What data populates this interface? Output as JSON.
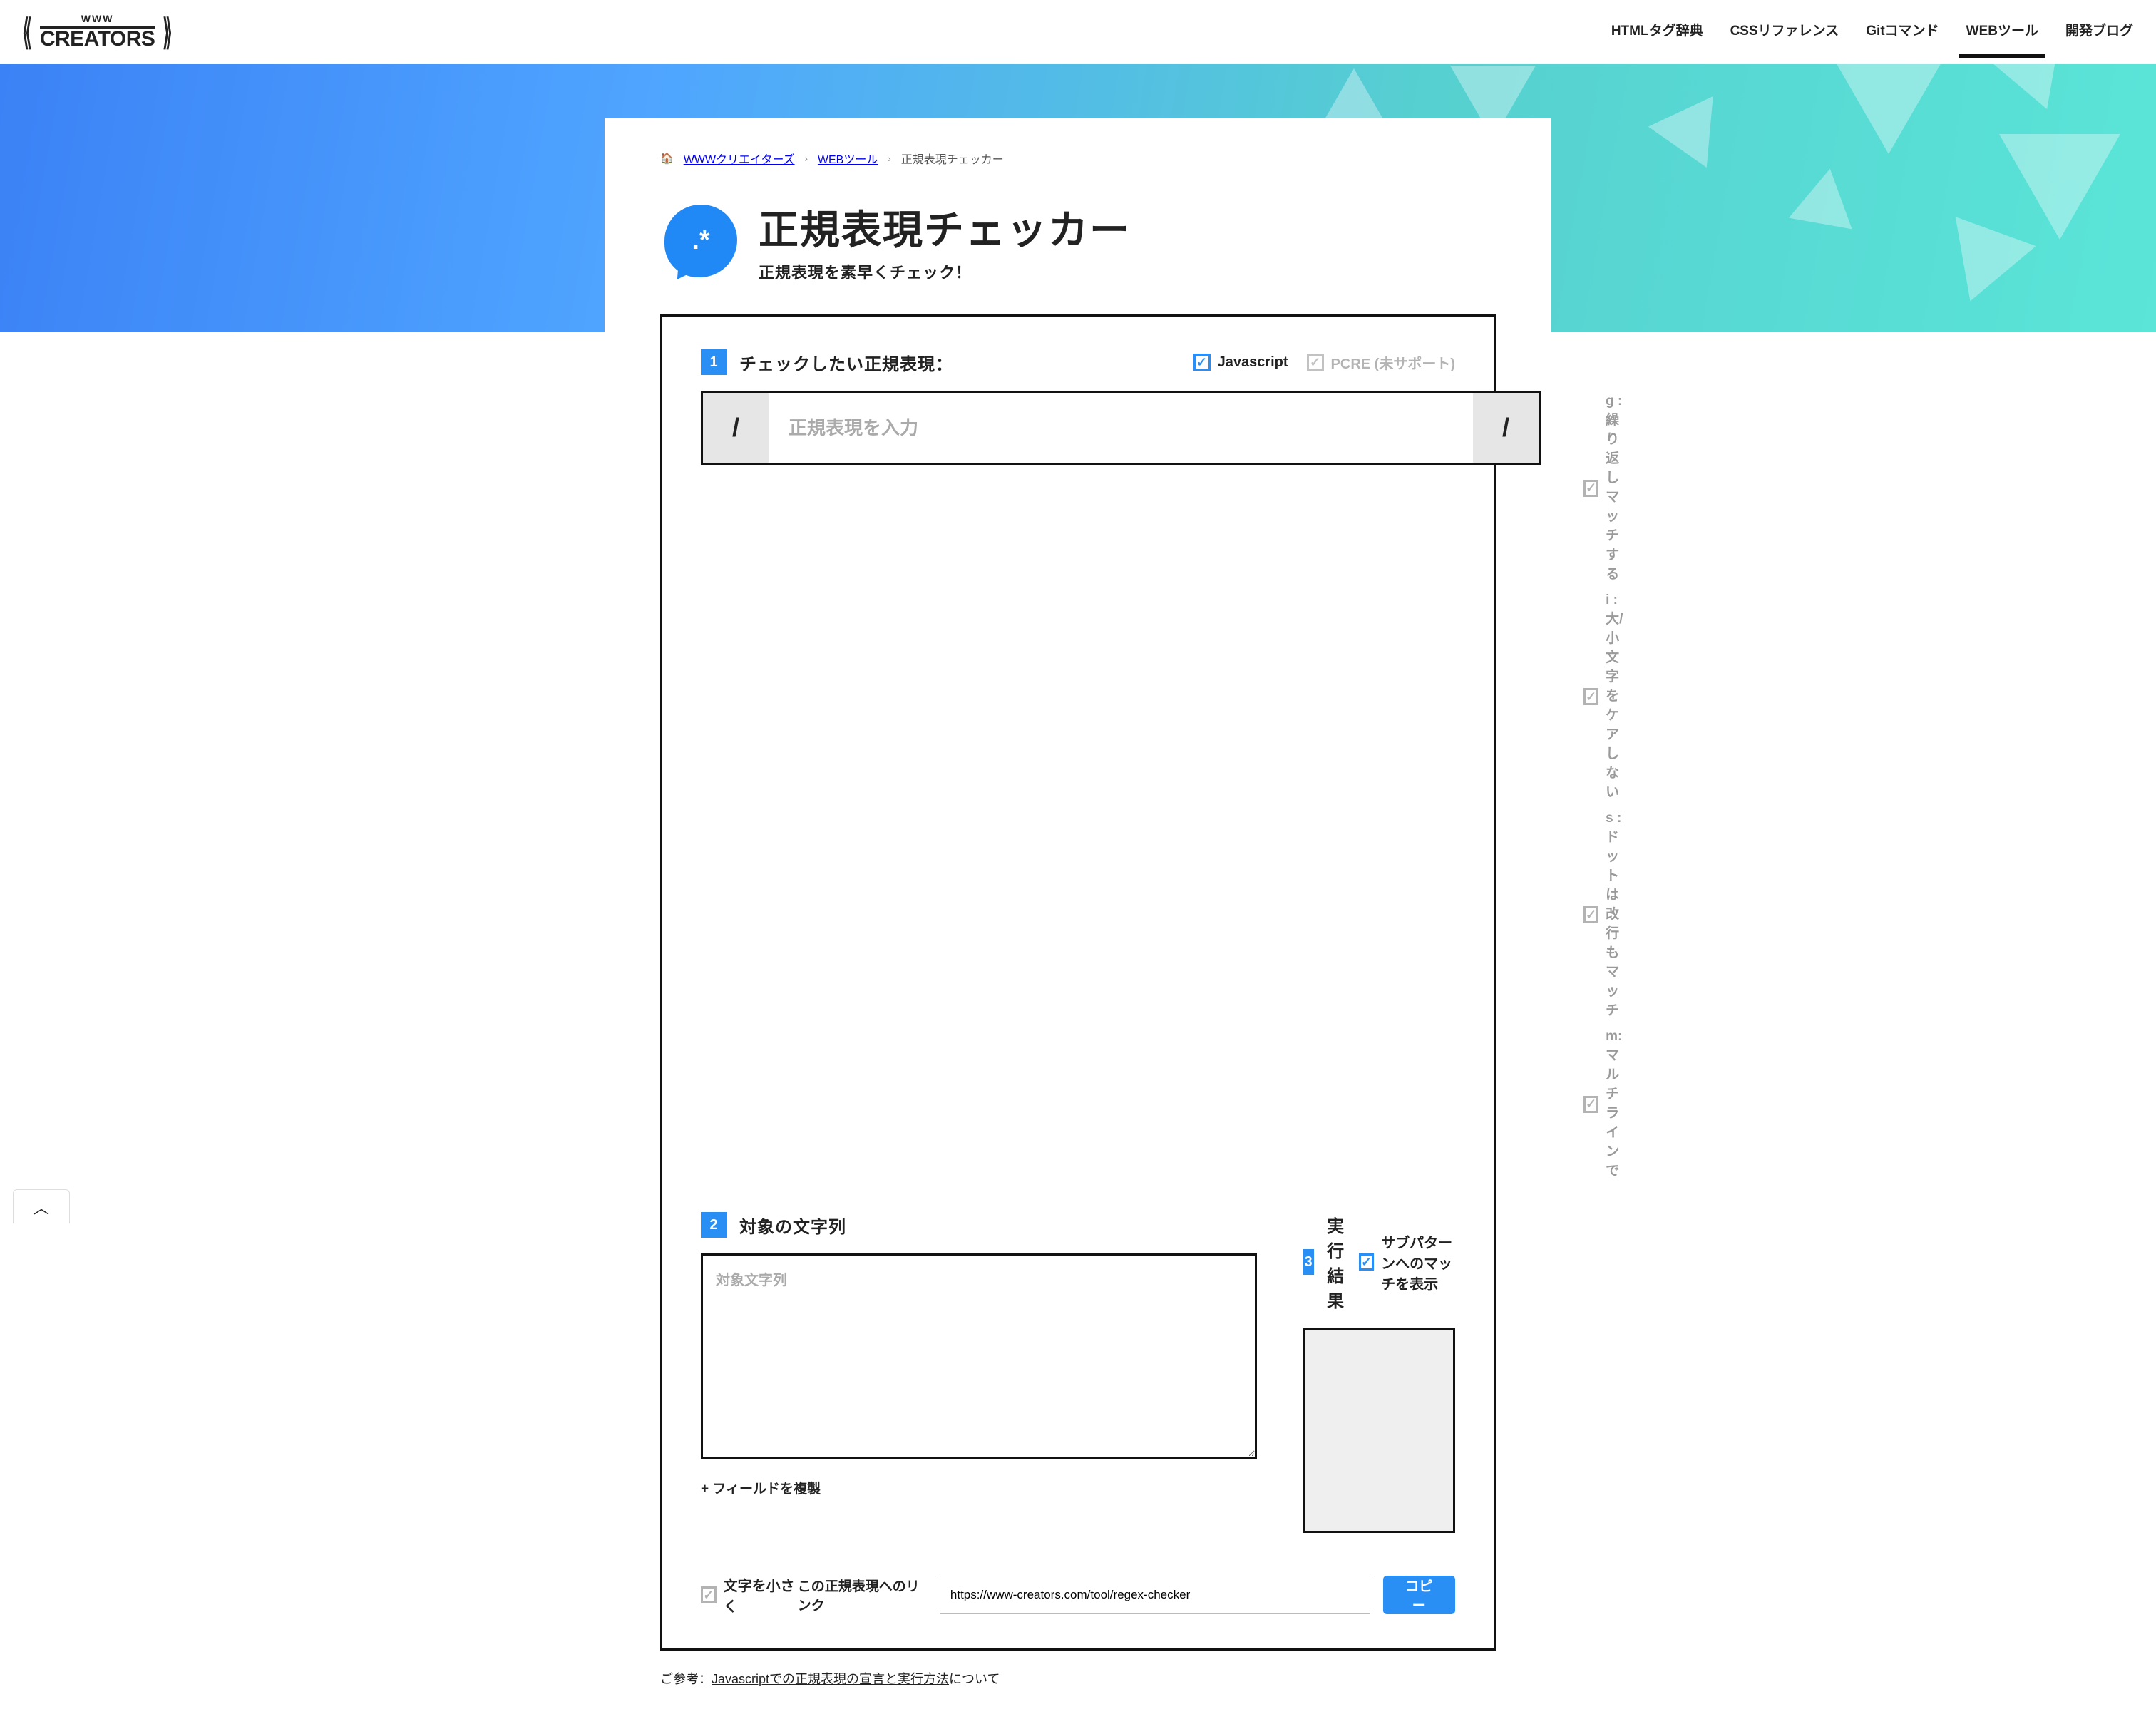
{
  "site": {
    "logo_top": "WWW",
    "logo_main": "CREATORS"
  },
  "nav": {
    "items": [
      {
        "label": "HTMLタグ辞典",
        "active": false
      },
      {
        "label": "CSSリファレンス",
        "active": false
      },
      {
        "label": "Gitコマンド",
        "active": false
      },
      {
        "label": "WEBツール",
        "active": true
      },
      {
        "label": "開発ブログ",
        "active": false
      }
    ]
  },
  "breadcrumb": {
    "items": [
      "WWWクリエイターズ",
      "WEBツール",
      "正規表現チェッカー"
    ]
  },
  "page": {
    "icon_text": ".*",
    "title": "正規表現チェッカー",
    "subtitle": "正規表現を素早くチェック！"
  },
  "section1": {
    "num": "1",
    "label": "チェックしたい正規表現：",
    "engine_js": "Javascript",
    "engine_pcre": "PCRE (未サポート)",
    "slash": "/",
    "slash_end": "/",
    "placeholder": "正規表現を入力",
    "flags": [
      "g : 繰り返しマッチする",
      "i  : 大/小文字をケアしない",
      "s  : ドットは改行もマッチ",
      "m: マルチラインで"
    ]
  },
  "section2": {
    "num": "2",
    "label": "対象の文字列",
    "placeholder": "対象文字列",
    "duplicate": "+ フィールドを複製"
  },
  "section3": {
    "num": "3",
    "label": "実行結果",
    "sub_checkbox": "サブパターンへのマッチを表示"
  },
  "bottom": {
    "small_text_toggle": "文字を小さく",
    "link_label": "この正規表現へのリンク",
    "link_value": "https://www-creators.com/tool/regex-checker",
    "copy": "コピー"
  },
  "reference": {
    "prefix": "ご参考：",
    "link_text": "Javascriptでの正規表現の宣言と実行方法",
    "suffix": "について"
  }
}
